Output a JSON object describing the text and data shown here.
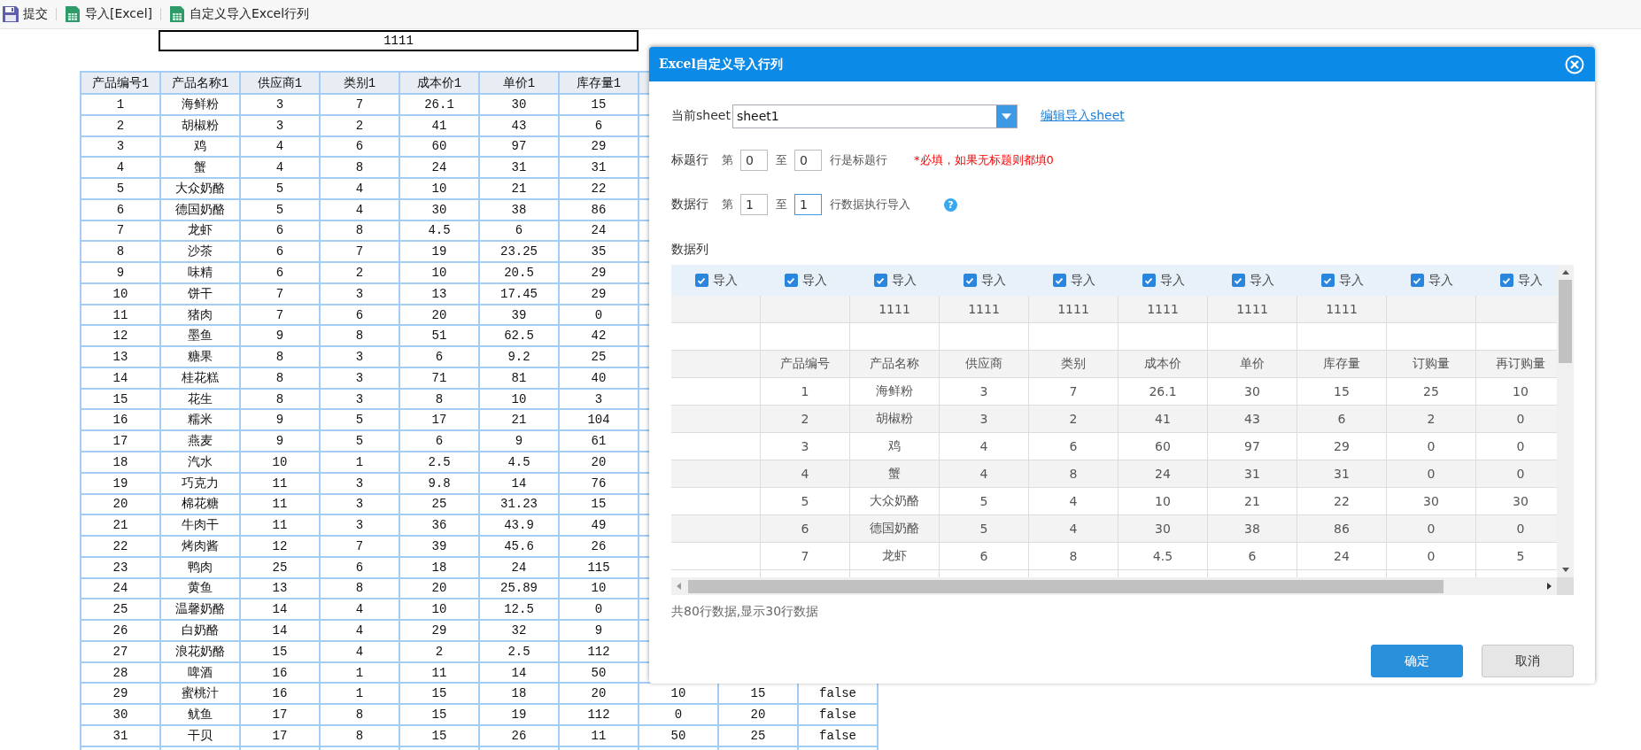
{
  "toolbar": [
    {
      "kind": "save",
      "label": "提交"
    },
    {
      "kind": "excel",
      "label": "导入[Excel]"
    },
    {
      "kind": "excel",
      "label": "自定义导入Excel行列"
    }
  ],
  "report_title": "1111",
  "table": {
    "columns": [
      "产品编号1",
      "产品名称1",
      "供应商1",
      "类别1",
      "成本价1",
      "单价1",
      "库存量1"
    ],
    "rows": [
      [
        "1",
        "海鲜粉",
        "3",
        "7",
        "26.1",
        "30",
        "15"
      ],
      [
        "2",
        "胡椒粉",
        "3",
        "2",
        "41",
        "43",
        "6"
      ],
      [
        "3",
        "鸡",
        "4",
        "6",
        "60",
        "97",
        "29"
      ],
      [
        "4",
        "蟹",
        "4",
        "8",
        "24",
        "31",
        "31"
      ],
      [
        "5",
        "大众奶酪",
        "5",
        "4",
        "10",
        "21",
        "22"
      ],
      [
        "6",
        "德国奶酪",
        "5",
        "4",
        "30",
        "38",
        "86"
      ],
      [
        "7",
        "龙虾",
        "6",
        "8",
        "4.5",
        "6",
        "24"
      ],
      [
        "8",
        "沙茶",
        "6",
        "7",
        "19",
        "23.25",
        "35"
      ],
      [
        "9",
        "味精",
        "6",
        "2",
        "10",
        "20.5",
        "29"
      ],
      [
        "10",
        "饼干",
        "7",
        "3",
        "13",
        "17.45",
        "29"
      ],
      [
        "11",
        "猪肉",
        "7",
        "6",
        "20",
        "39",
        "0"
      ],
      [
        "12",
        "墨鱼",
        "9",
        "8",
        "51",
        "62.5",
        "42"
      ],
      [
        "13",
        "糖果",
        "8",
        "3",
        "6",
        "9.2",
        "25"
      ],
      [
        "14",
        "桂花糕",
        "8",
        "3",
        "71",
        "81",
        "40"
      ],
      [
        "15",
        "花生",
        "8",
        "3",
        "8",
        "10",
        "3"
      ],
      [
        "16",
        "糯米",
        "9",
        "5",
        "17",
        "21",
        "104"
      ],
      [
        "17",
        "燕麦",
        "9",
        "5",
        "6",
        "9",
        "61"
      ],
      [
        "18",
        "汽水",
        "10",
        "1",
        "2.5",
        "4.5",
        "20"
      ],
      [
        "19",
        "巧克力",
        "11",
        "3",
        "9.8",
        "14",
        "76"
      ],
      [
        "20",
        "棉花糖",
        "11",
        "3",
        "25",
        "31.23",
        "15"
      ],
      [
        "21",
        "牛肉干",
        "11",
        "3",
        "36",
        "43.9",
        "49"
      ],
      [
        "22",
        "烤肉酱",
        "12",
        "7",
        "39",
        "45.6",
        "26"
      ],
      [
        "23",
        "鸭肉",
        "25",
        "6",
        "18",
        "24",
        "115"
      ],
      [
        "24",
        "黄鱼",
        "13",
        "8",
        "20",
        "25.89",
        "10"
      ],
      [
        "25",
        "温馨奶酪",
        "14",
        "4",
        "10",
        "12.5",
        "0"
      ],
      [
        "26",
        "白奶酪",
        "14",
        "4",
        "29",
        "32",
        "9"
      ],
      [
        "27",
        "浪花奶酪",
        "15",
        "4",
        "2",
        "2.5",
        "112"
      ],
      [
        "28",
        "啤酒",
        "16",
        "1",
        "11",
        "14",
        "50"
      ],
      [
        "29",
        "蜜桃汁",
        "16",
        "1",
        "15",
        "18",
        "20",
        "10",
        "15",
        "false"
      ],
      [
        "30",
        "鱿鱼",
        "17",
        "8",
        "15",
        "19",
        "112",
        "0",
        "20",
        "false"
      ],
      [
        "31",
        "干贝",
        "17",
        "8",
        "15",
        "26",
        "11",
        "50",
        "25",
        "false"
      ]
    ]
  },
  "dialog": {
    "title": "Excel自定义导入行列",
    "sheet_label": "当前sheet",
    "sheet_value": "sheet1",
    "edit_link": "编辑导入sheet",
    "title_row": {
      "label": "标题行",
      "from_word": "第",
      "from": "0",
      "to_word": "至",
      "to": "0",
      "suffix": "行是标题行",
      "note": "*必填，如果无标题则都填0"
    },
    "data_row": {
      "label": "数据行",
      "from_word": "第",
      "from": "1",
      "to_word": "至",
      "to": "1",
      "suffix": "行数据执行导入",
      "help": "?"
    },
    "columns_label": "数据列",
    "grid": {
      "checks": [
        {
          "label": "导入",
          "checked": true
        },
        {
          "label": "导入",
          "checked": true
        },
        {
          "label": "导入",
          "checked": true
        },
        {
          "label": "导入",
          "checked": true
        },
        {
          "label": "导入",
          "checked": true
        },
        {
          "label": "导入",
          "checked": true
        },
        {
          "label": "导入",
          "checked": true
        },
        {
          "label": "导入",
          "checked": true
        },
        {
          "label": "导入",
          "checked": true
        },
        {
          "label": "导入",
          "checked": true
        }
      ],
      "rows": [
        [
          null,
          null,
          "1111",
          "1111",
          "1111",
          "1111",
          "1111",
          "1111",
          null,
          null
        ],
        [
          null,
          null,
          null,
          null,
          null,
          null,
          null,
          null,
          null,
          null
        ],
        [
          null,
          "产品编号",
          "产品名称",
          "供应商",
          "类别",
          "成本价",
          "单价",
          "库存量",
          "订购量",
          "再订购量"
        ],
        [
          null,
          "1",
          "海鲜粉",
          "3",
          "7",
          "26.1",
          "30",
          "15",
          "25",
          "10"
        ],
        [
          null,
          "2",
          "胡椒粉",
          "3",
          "2",
          "41",
          "43",
          "6",
          "2",
          "0"
        ],
        [
          null,
          "3",
          "鸡",
          "4",
          "6",
          "60",
          "97",
          "29",
          "0",
          "0"
        ],
        [
          null,
          "4",
          "蟹",
          "4",
          "8",
          "24",
          "31",
          "31",
          "0",
          "0"
        ],
        [
          null,
          "5",
          "大众奶酪",
          "5",
          "4",
          "10",
          "21",
          "22",
          "30",
          "30"
        ],
        [
          null,
          "6",
          "德国奶酪",
          "5",
          "4",
          "30",
          "38",
          "86",
          "0",
          "0"
        ],
        [
          null,
          "7",
          "龙虾",
          "6",
          "8",
          "4.5",
          "6",
          "24",
          "0",
          "5"
        ]
      ]
    },
    "summary": "共80行数据,显示30行数据",
    "buttons": [
      {
        "kind": "primary",
        "label": "确定"
      },
      {
        "kind": "default",
        "label": "取消"
      }
    ]
  }
}
